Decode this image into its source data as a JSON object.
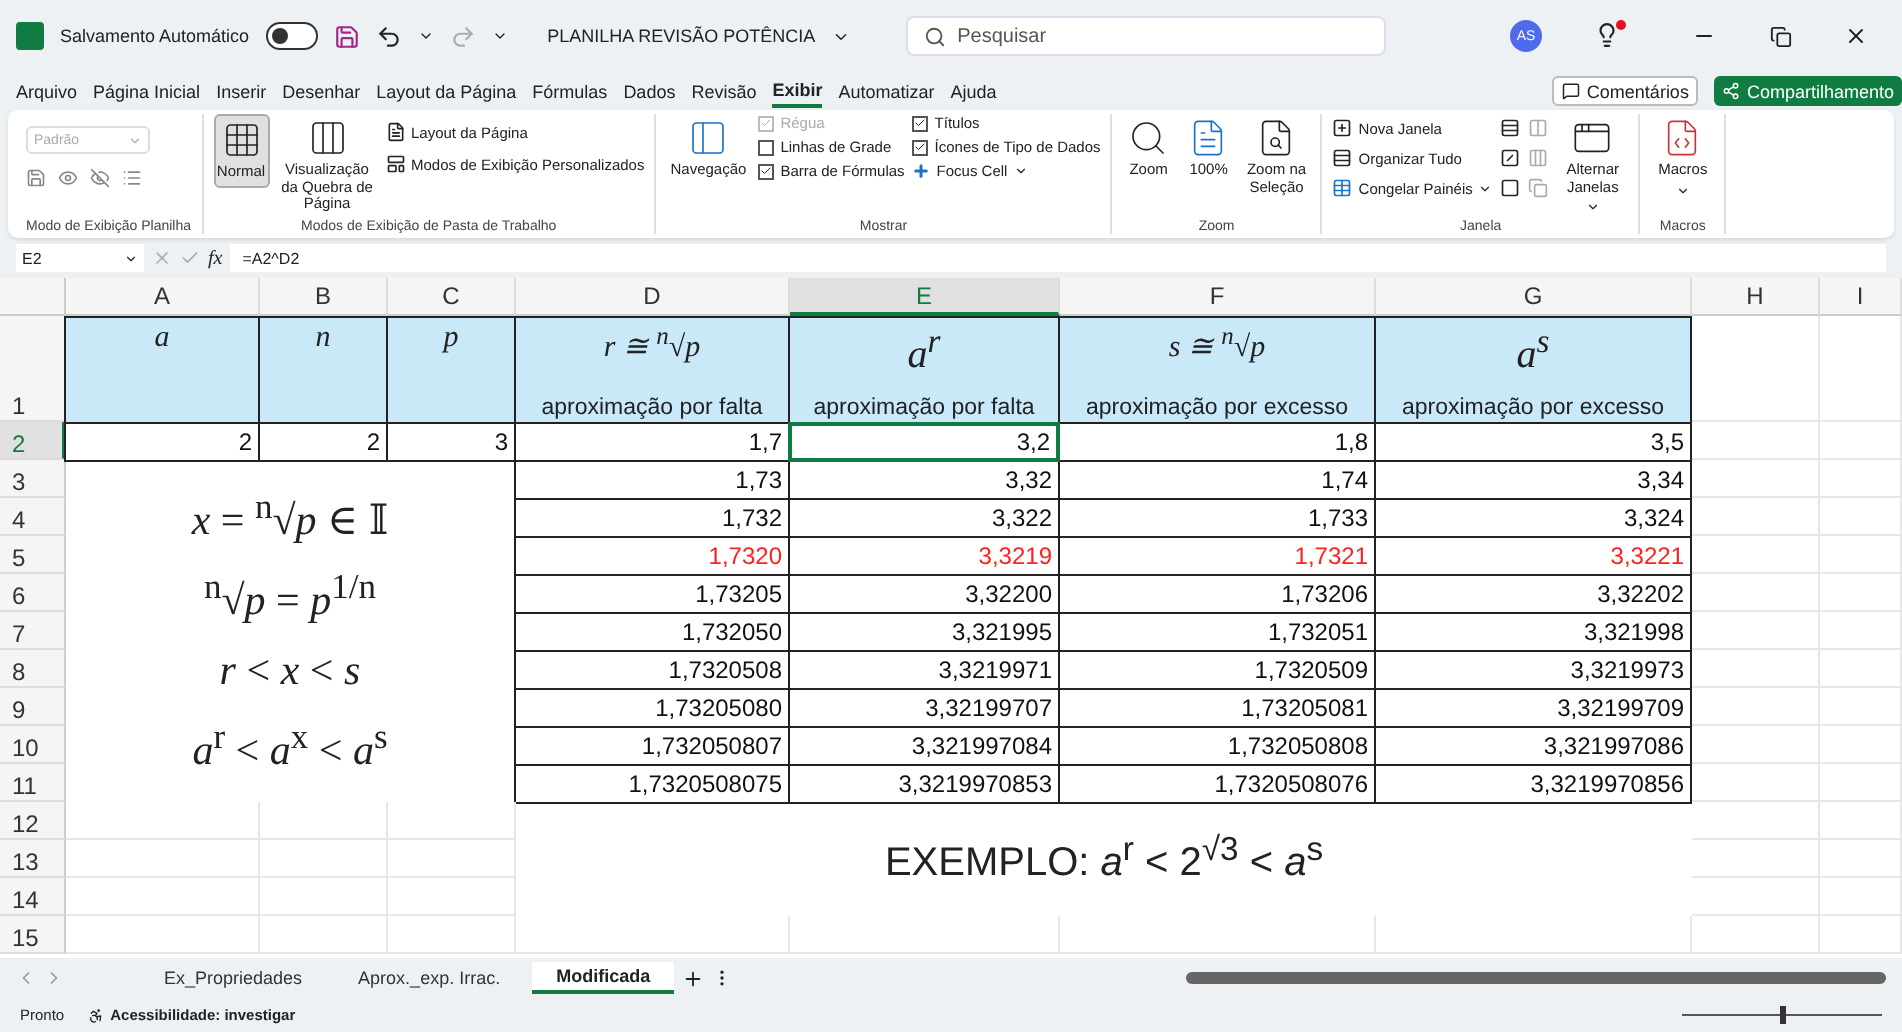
{
  "title_bar": {
    "autosave_label": "Salvamento Automático",
    "autosave_on": false,
    "document_title": "PLANILHA  REVISÃO POTÊNCIA",
    "search_placeholder": "Pesquisar",
    "avatar_initials": "AS",
    "notification": true
  },
  "menu": {
    "tabs": [
      {
        "label": "Arquivo",
        "selected": false
      },
      {
        "label": "Página Inicial",
        "selected": false
      },
      {
        "label": "Inserir",
        "selected": false
      },
      {
        "label": "Desenhar",
        "selected": false
      },
      {
        "label": "Layout da Página",
        "selected": false
      },
      {
        "label": "Fórmulas",
        "selected": false
      },
      {
        "label": "Dados",
        "selected": false
      },
      {
        "label": "Revisão",
        "selected": false
      },
      {
        "label": "Exibir",
        "selected": true
      },
      {
        "label": "Automatizar",
        "selected": false
      },
      {
        "label": "Ajuda",
        "selected": false
      }
    ],
    "comments_button": "Comentários",
    "share_button": "Compartilhamento"
  },
  "ribbon": {
    "sheet_view": {
      "label": "Modo de Exibição Planilha",
      "dropdown": "Padrão"
    },
    "workbook_views": {
      "label": "Modos de Exibição de Pasta de Trabalho",
      "large": [
        {
          "label": "Normal",
          "selected": true
        },
        {
          "label": "Visualização da Quebra de Página",
          "selected": false
        }
      ],
      "small": [
        "Layout da Página",
        "Modos de Exibição Personalizados"
      ]
    },
    "show": {
      "label": "Mostrar",
      "navigation": "Navegação",
      "checkboxes": [
        {
          "label": "Régua",
          "checked": true,
          "disabled": true
        },
        {
          "label": "Linhas de Grade",
          "checked": false,
          "disabled": false
        },
        {
          "label": "Barra de Fórmulas",
          "checked": true,
          "disabled": false
        },
        {
          "label": "Títulos",
          "checked": true,
          "disabled": false
        },
        {
          "label": "Ícones de Tipo de Dados",
          "checked": true,
          "disabled": false
        }
      ],
      "focus_cell": "Focus Cell"
    },
    "zoom": {
      "label": "Zoom",
      "buttons": [
        "Zoom",
        "100%",
        "Zoom na Seleção"
      ]
    },
    "window": {
      "label": "Janela",
      "commands": [
        "Nova Janela",
        "Organizar Tudo",
        "Congelar Painéis"
      ],
      "switch_windows": "Alternar Janelas"
    },
    "macros": {
      "label": "Macros",
      "button": "Macros"
    }
  },
  "formula_bar": {
    "name_box": "E2",
    "function_symbol": "fx",
    "formula": "=A2^D2"
  },
  "sheet": {
    "columns": [
      {
        "label": "A",
        "selected": false
      },
      {
        "label": "B",
        "selected": false
      },
      {
        "label": "C",
        "selected": false
      },
      {
        "label": "D",
        "selected": false
      },
      {
        "label": "E",
        "selected": true
      },
      {
        "label": "F",
        "selected": false
      },
      {
        "label": "G",
        "selected": false
      },
      {
        "label": "H",
        "selected": false
      },
      {
        "label": "I",
        "selected": false
      }
    ],
    "rows": [
      {
        "label": "1",
        "selected": false
      },
      {
        "label": "2",
        "selected": true
      },
      {
        "label": "3",
        "selected": false
      },
      {
        "label": "4",
        "selected": false
      },
      {
        "label": "5",
        "selected": false
      },
      {
        "label": "6",
        "selected": false
      },
      {
        "label": "7",
        "selected": false
      },
      {
        "label": "8",
        "selected": false
      },
      {
        "label": "9",
        "selected": false
      },
      {
        "label": "10",
        "selected": false
      },
      {
        "label": "11",
        "selected": false
      },
      {
        "label": "12",
        "selected": false
      },
      {
        "label": "13",
        "selected": false
      },
      {
        "label": "14",
        "selected": false
      },
      {
        "label": "15",
        "selected": false
      }
    ],
    "headers": [
      {
        "title": "a"
      },
      {
        "title": "n"
      },
      {
        "title": "p"
      },
      {
        "title": "r ≅ $^{n}$√p",
        "caption": "aproximação por falta"
      },
      {
        "title": "a$^{r}$",
        "caption": "aproximação por falta"
      },
      {
        "title": "s ≅ $^{n}$√p",
        "caption": "aproximação por excesso"
      },
      {
        "title": "a$^{s}$",
        "caption": "aproximação por excesso"
      }
    ],
    "input_row": [
      {
        "value": "2",
        "selected": false
      },
      {
        "value": "2",
        "selected": false
      },
      {
        "value": "3",
        "selected": false
      },
      {
        "value": "1,7",
        "selected": false
      },
      {
        "value": "3,2",
        "selected": true
      },
      {
        "value": "1,8",
        "selected": false
      },
      {
        "value": "3,5",
        "selected": false
      }
    ],
    "approximations": [
      {
        "values": [
          "1,73",
          "3,32",
          "1,74",
          "3,34"
        ],
        "highlighted": false
      },
      {
        "values": [
          "1,732",
          "3,322",
          "1,733",
          "3,324"
        ],
        "highlighted": false
      },
      {
        "values": [
          "1,7320",
          "3,3219",
          "1,7321",
          "3,3221"
        ],
        "highlighted": true
      },
      {
        "values": [
          "1,73205",
          "3,32200",
          "1,73206",
          "3,32202"
        ],
        "highlighted": false
      },
      {
        "values": [
          "1,732050",
          "3,321995",
          "1,732051",
          "3,321998"
        ],
        "highlighted": false
      },
      {
        "values": [
          "1,7320508",
          "3,3219971",
          "1,7320509",
          "3,3219973"
        ],
        "highlighted": false
      },
      {
        "values": [
          "1,73205080",
          "3,32199707",
          "1,73205081",
          "3,32199709"
        ],
        "highlighted": false
      },
      {
        "values": [
          "1,732050807",
          "3,321997084",
          "1,732050808",
          "3,321997086"
        ],
        "highlighted": false
      },
      {
        "values": [
          "1,7320508075",
          "3,3219970853",
          "1,7320508076",
          "3,3219970856"
        ],
        "highlighted": false
      }
    ],
    "formulas": [
      "*x* = $^{n}$√*p* ∈ 𝕀",
      "$^{n}$√*p* = *p*$^{1/n}$",
      "*r* < *x* < *s*",
      "*a*$^{r}$ < *a*$^{x}$ < *a*$^{s}$"
    ],
    "example": "EXEMPLO: *a*$^{r}$ < 2$^{√3}$ < *a*$^{s}$"
  },
  "sheet_tabs": [
    {
      "label": "Ex_Propriedades",
      "selected": false
    },
    {
      "label": "Aprox._exp. Irrac.",
      "selected": false
    },
    {
      "label": "Modificada",
      "selected": true
    }
  ],
  "status_bar": {
    "ready": "Pronto",
    "accessibility": "Acessibilidade: investigar",
    "zoom_slider": {
      "level": 0.5
    }
  }
}
